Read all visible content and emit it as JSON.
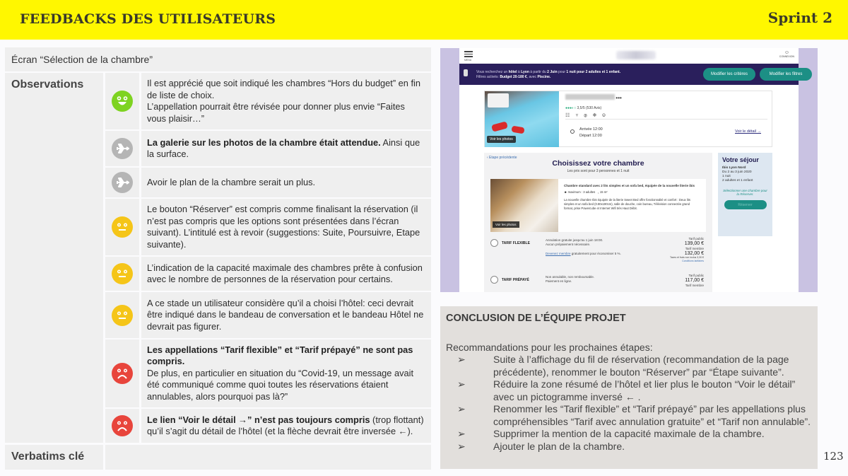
{
  "header": {
    "title": "FEEDBACKS DES UTILISATEURS",
    "sprint": "Sprint 2"
  },
  "table": {
    "screen_title": "Écran “Sélection de la chambre”",
    "observations_label": "Observations",
    "verbatims_label": "Verbatims clé",
    "rows": [
      {
        "sentiment": "positive",
        "icon": "happy-smiley-icon",
        "color": "#7ed321",
        "bold": "",
        "text": "Il est apprécié que soit indiqué les chambres “Hors du budget” en fin de liste de choix.",
        "text2": "L’appellation pourrait être révisée pour donner plus envie “Faites vous plaisir…”"
      },
      {
        "sentiment": "suggestion",
        "icon": "airplane-icon",
        "color": "#b5b5b5",
        "bold": "La galerie sur les photos de la chambre était attendue.",
        "text": " Ainsi que la surface.",
        "text2": ""
      },
      {
        "sentiment": "suggestion",
        "icon": "airplane-icon",
        "color": "#b5b5b5",
        "bold": "",
        "text": "Avoir le plan de la chambre serait un plus.",
        "text2": ""
      },
      {
        "sentiment": "neutral",
        "icon": "neutral-smiley-icon",
        "color": "#f5c518",
        "bold": "",
        "text": "Le bouton “Réserver” est compris comme finalisant la réservation (il n’est pas compris que les options sont présentées dans l’écran suivant). L’intitulé est à revoir (suggestions: Suite, Poursuivre, Etape suivante).",
        "text2": ""
      },
      {
        "sentiment": "neutral",
        "icon": "neutral-smiley-icon",
        "color": "#f5c518",
        "bold": "",
        "text": "L’indication de la capacité maximale des chambres prête à confusion avec le nombre de personnes de la réservation pour certains.",
        "text2": ""
      },
      {
        "sentiment": "neutral",
        "icon": "neutral-smiley-icon",
        "color": "#f5c518",
        "bold": "",
        "text": "A ce stade un utilisateur considère qu’il a choisi l’hôtel: ceci devrait être indiqué dans le bandeau de conversation et le bandeau Hôtel ne devrait pas figurer.",
        "text2": ""
      },
      {
        "sentiment": "negative",
        "icon": "sad-smiley-icon",
        "color": "#e8453c",
        "bold": "Les appellations “Tarif flexible” et “Tarif prépayé” ne sont pas compris.",
        "text": "",
        "text2": "De plus, en particulier en situation du “Covid-19, un message avait été communiqué comme quoi toutes les réservations étaient annulables, alors pourquoi pas là?”"
      },
      {
        "sentiment": "negative",
        "icon": "sad-smiley-icon",
        "color": "#e8453c",
        "bold": "Le lien “Voir le détail →” n’est pas toujours compris",
        "text": " (trop flottant) qu’il s’agit du détail de l’hôtel (et la flèche devrait être inversée ←).",
        "text2": ""
      }
    ]
  },
  "mockup": {
    "menu_label": "MENU",
    "connexion_label": "CONNEXION",
    "banner_line1_pre": "Vous recherchez un ",
    "banner_line1_b1": "hôtel",
    "banner_line1_mid": " à ",
    "banner_line1_b2": "Lyon",
    "banner_line1_mid2": " à partir du ",
    "banner_line1_b3": "2 Juin",
    "banner_line1_mid3": " pour ",
    "banner_line1_b4": "1 nuit pour 2 adultes et 1 enfant.",
    "banner_line2_pre": "Filtres activés: ",
    "banner_line2_b1": "Budget 20-180 €",
    "banner_line2_mid": ", avec ",
    "banner_line2_b2": "Piscine.",
    "modify_criteria": "Modifier les critères",
    "modify_filters": "Modifier les filtres",
    "hotel": {
      "stars": "•••",
      "rating_dots": "●●●◐○",
      "rating": "3,5/5",
      "reviews": "(530 Avis)",
      "amenities": "☷ ⑂ Ⓟ ❄ ⎉",
      "arrival": "Arrivée 12:00",
      "departure": "Départ 12:00",
      "see_detail": "Voir le détail →",
      "see_photos": "Voir les photos"
    },
    "prev_step": "‹ Etape précédente",
    "room_title": "Choisissez votre chambre",
    "room_subtitle": "Les prix sont pour 3 personnes et 1 nuit",
    "room": {
      "name": "Chambre standard avec 2 lits simples et un sofa bed, équipée de la nouvelle literie ibis",
      "capacity": "maximum : 3 adultes",
      "surface": "15 m²",
      "description": "La nouvelle chambre Ibis équipée de la literie Sweet Bed offre fonctionnalité et confort : Deux lits simples et un sofa bed (0.80x190cm), salle de douche, coin bureau, Télévision connectée grand format, prise Powercube et Internet Wifi très Haut Débit.",
      "see_photos": "Voir les photos"
    },
    "tarifs": [
      {
        "name": "TARIF FLEXIBLE",
        "cond1": "Annulation gratuite jusqu’au 1 juin 18:00.",
        "cond2": "Aucun prépaiement nécessaire.",
        "member_link": "Devenez membre",
        "member_text": " gratuitement pour économiser 5 %.",
        "public_label": "Tarif public",
        "public_price": "139,00 €",
        "member_label": "Tarif membre",
        "member_price": "132,00 €",
        "taxes": "Taxes et frais non inclus 3,30 €",
        "conditions": "Conditions tarifaires"
      },
      {
        "name": "TARIF PRÉPAYÉ",
        "cond1": "Non annulable, non remboursable.",
        "cond2": "Paiement en ligne.",
        "public_label": "Tarif public",
        "public_price": "117,00 €",
        "member_label": "Tarif membre"
      }
    ],
    "sejour": {
      "title": "Votre séjour",
      "hotel": "Ibis Lyon Nord",
      "dates": "Du 2 au 3 juin 2020",
      "nights": "1 nuit",
      "guests": "2 adultes et 1 enfant",
      "hint": "Sélectionner une chambre pour la Réserver.",
      "book_button": "Réserver"
    }
  },
  "conclusion": {
    "title": "CONCLUSION DE L’ÉQUIPE PROJET",
    "intro": "Recommandations pour les prochaines étapes:",
    "bullet": "➢",
    "items": [
      "Suite à l’affichage du fil de réservation (recommandation de la page précédente), renommer le bouton “Réserver” par “Étape suivante”.",
      "Réduire la zone résumé de l’hôtel et lier plus le bouton “Voir le détail” avec un pictogramme inversé ← .",
      "Renommer les “Tarif flexible” et “Tarif prépayé” par les appellations plus compréhensibles “Tarif avec annulation gratuite” et “Tarif non annulable”.",
      "Supprimer la mention de la capacité maximale de la chambre.",
      "Ajouter le plan de la chambre."
    ]
  },
  "page_number": "123"
}
